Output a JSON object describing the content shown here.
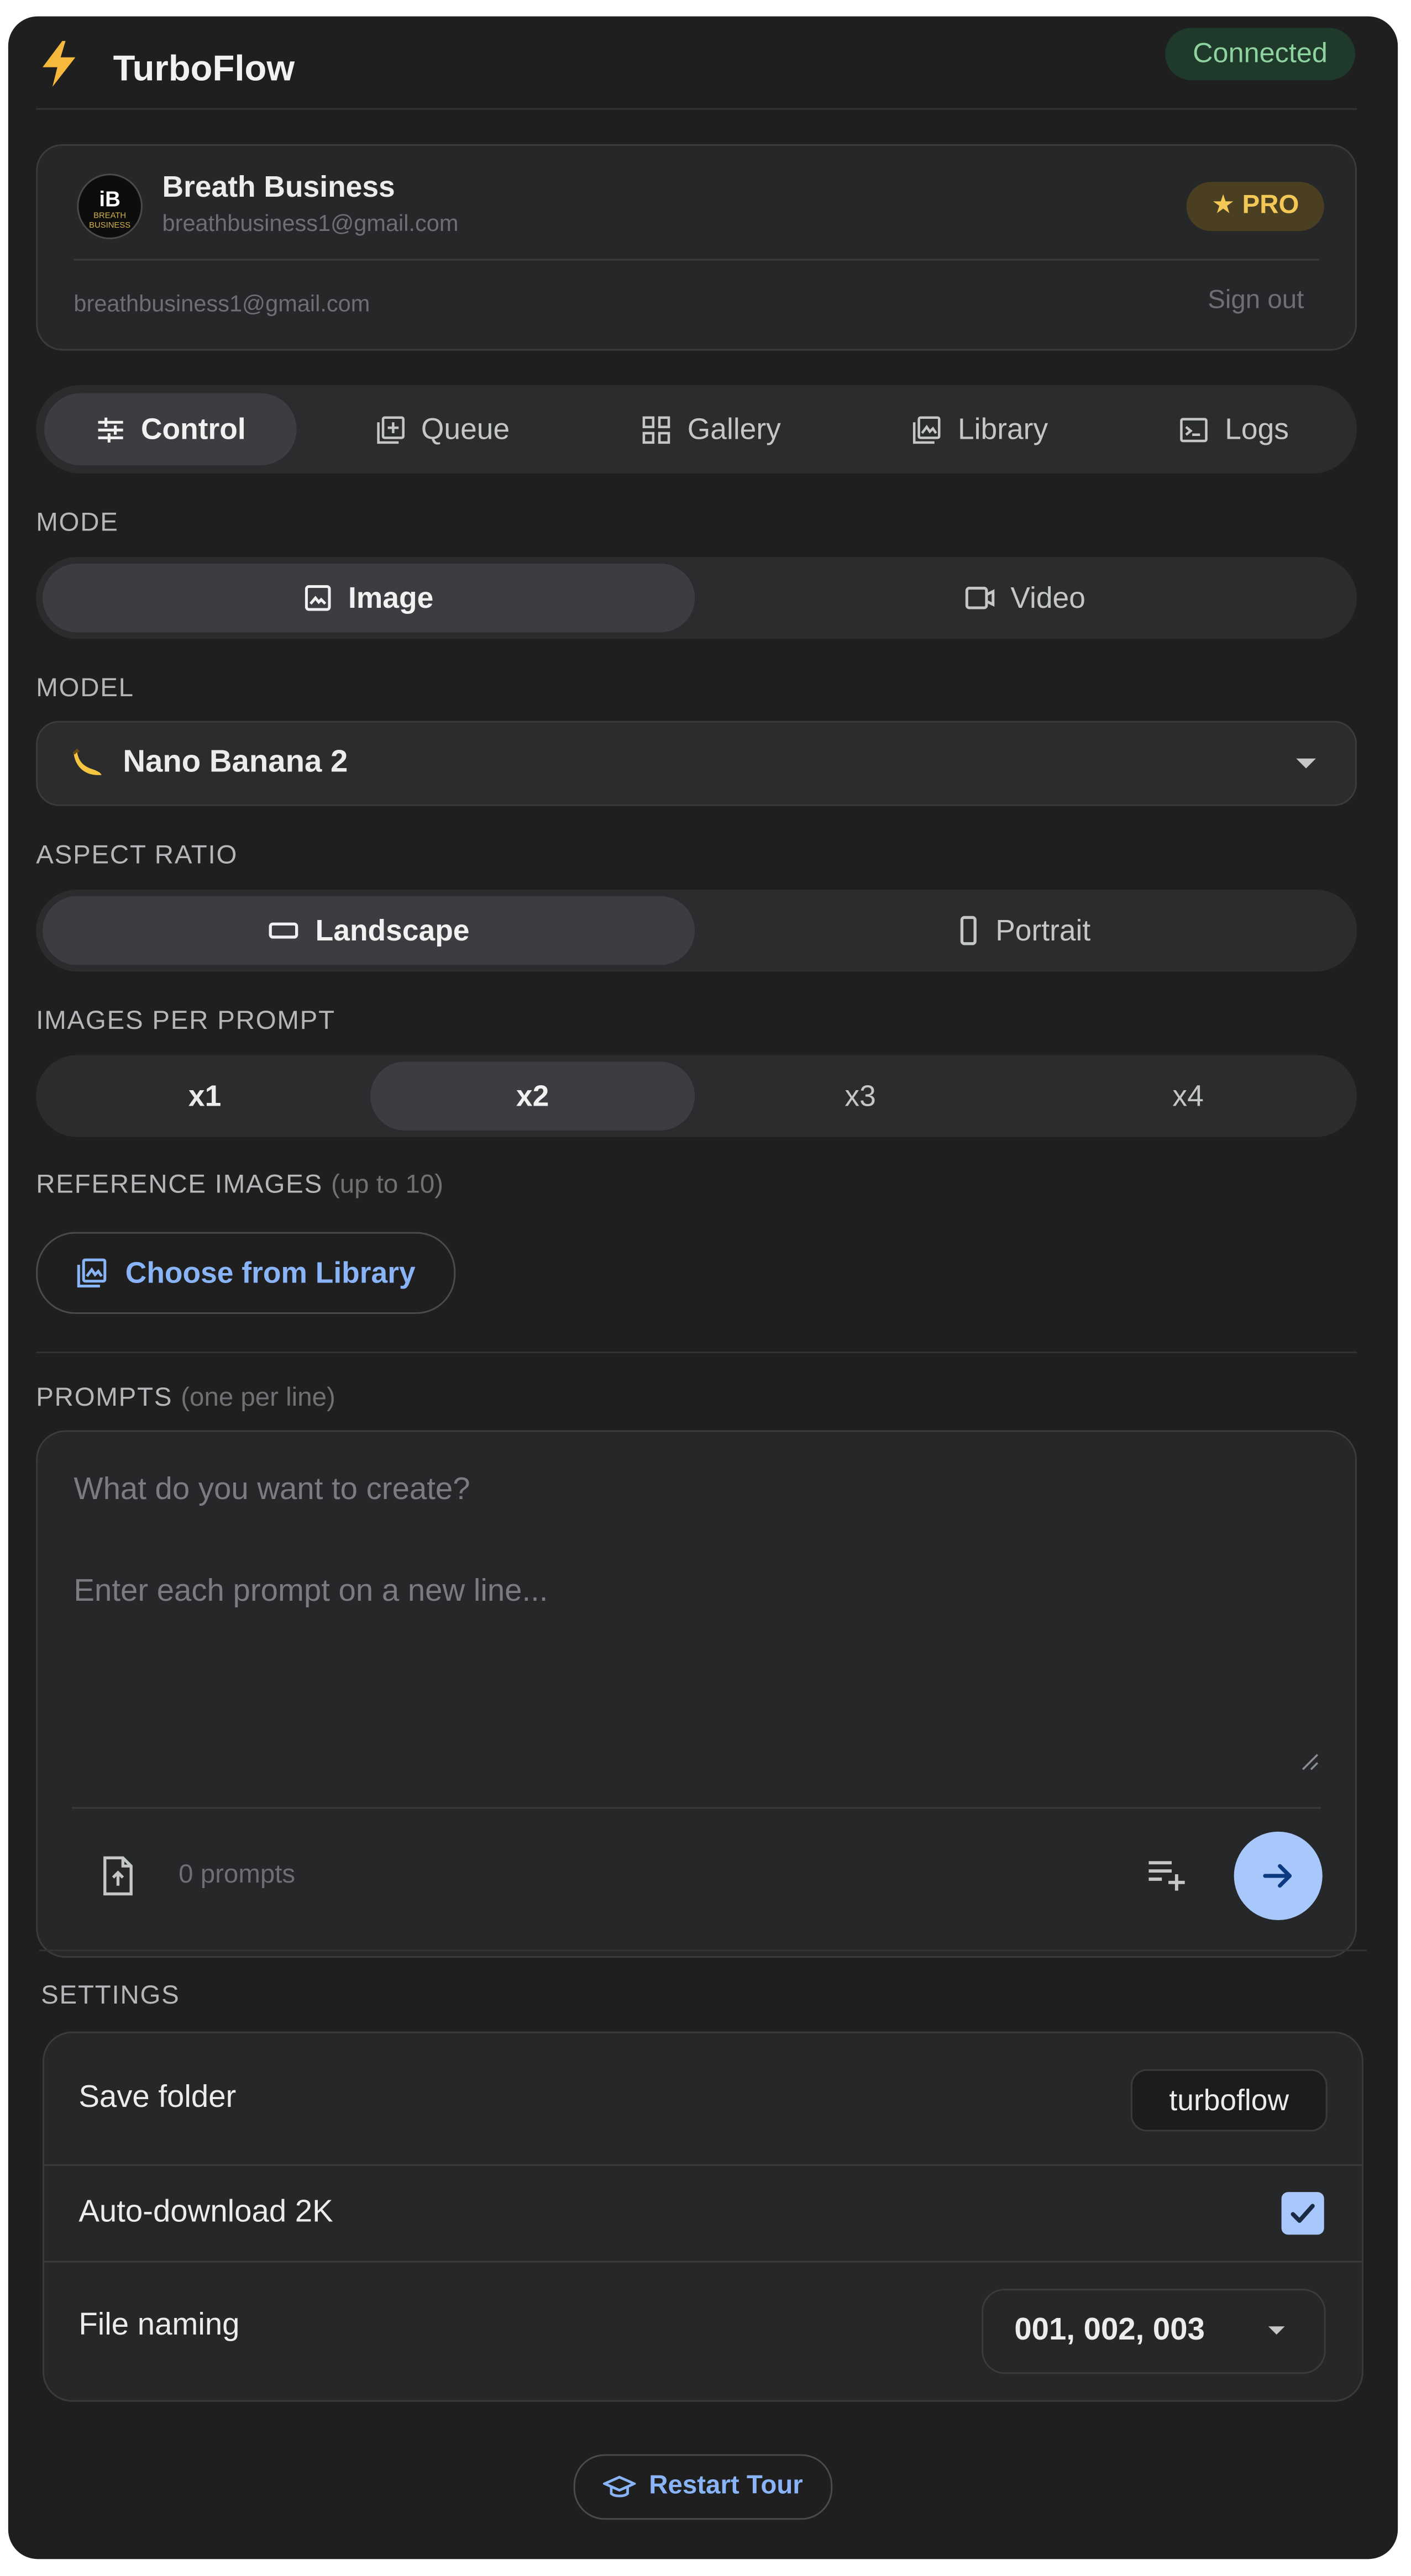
{
  "header": {
    "app_title": "TurboFlow",
    "connection_status": "Connected"
  },
  "account": {
    "avatar_text": "iB",
    "avatar_subtext": "BREATH BUSINESS",
    "name": "Breath Business",
    "email": "breathbusiness1@gmail.com",
    "plan_badge": "★ PRO",
    "footer_email": "breathbusiness1@gmail.com",
    "sign_out_label": "Sign out"
  },
  "tabs": [
    {
      "label": "Control",
      "icon": "sliders-icon",
      "active": true
    },
    {
      "label": "Queue",
      "icon": "queue-add-icon",
      "active": false
    },
    {
      "label": "Gallery",
      "icon": "grid-icon",
      "active": false
    },
    {
      "label": "Library",
      "icon": "photo-library-icon",
      "active": false
    },
    {
      "label": "Logs",
      "icon": "terminal-icon",
      "active": false
    }
  ],
  "mode": {
    "label": "MODE",
    "options": [
      {
        "label": "Image",
        "icon": "image-icon",
        "active": true
      },
      {
        "label": "Video",
        "icon": "video-camera-icon",
        "active": false
      }
    ]
  },
  "model": {
    "label": "MODEL",
    "selected": "Nano Banana 2",
    "icon": "banana-icon"
  },
  "aspect_ratio": {
    "label": "ASPECT RATIO",
    "options": [
      {
        "label": "Landscape",
        "icon": "landscape-icon",
        "active": true
      },
      {
        "label": "Portrait",
        "icon": "portrait-icon",
        "active": false
      }
    ]
  },
  "images_per_prompt": {
    "label": "IMAGES PER PROMPT",
    "options": [
      "x1",
      "x2",
      "x3",
      "x4"
    ],
    "selected_index": 1
  },
  "reference_images": {
    "label": "REFERENCE IMAGES",
    "hint": "(up to 10)",
    "button_label": "Choose from Library"
  },
  "prompts": {
    "label": "PROMPTS",
    "hint": "(one per line)",
    "placeholder": "What do you want to create?\n\nEnter each prompt on a new line...",
    "count_text": "0 prompts"
  },
  "settings": {
    "label": "SETTINGS",
    "save_folder_label": "Save folder",
    "save_folder_value": "turboflow",
    "auto_download_label": "Auto-download 2K",
    "auto_download_checked": true,
    "file_naming_label": "File naming",
    "file_naming_value": "001, 002, 003"
  },
  "restart_tour_label": "Restart Tour",
  "colors": {
    "background": "#1f1f1f",
    "accent_blue": "#8ab4f8",
    "send_button": "#a8c7fa",
    "connected_green": "#8ed29f",
    "pro_gold": "#f4c857"
  }
}
